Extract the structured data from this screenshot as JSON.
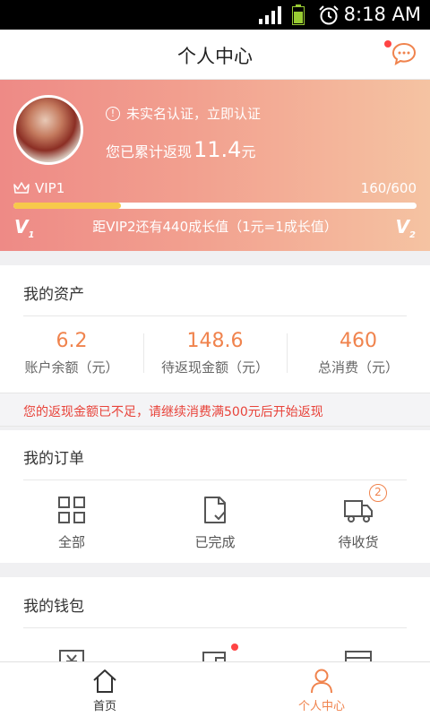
{
  "status_bar": {
    "time": "8:18 AM"
  },
  "header": {
    "title": "个人中心"
  },
  "profile": {
    "verify_text": "未实名认证，立即认证",
    "cashback_label": "您已累计返现",
    "cashback_amount": "11.4",
    "cashback_unit": "元",
    "vip_level": "VIP1",
    "growth_progress": "160/600",
    "progress_fraction": 0.267,
    "growth_hint": "距VIP2还有440成长值（1元=1成长值）",
    "level_from": "V",
    "level_from_num": "1",
    "level_to": "V",
    "level_to_num": "2"
  },
  "assets": {
    "title": "我的资产",
    "items": [
      {
        "value": "6.2",
        "label": "账户余额（元）"
      },
      {
        "value": "148.6",
        "label": "待返现金额（元）"
      },
      {
        "value": "460",
        "label": "总消费（元）"
      }
    ]
  },
  "notice": {
    "text": "您的返现金额已不足，请继续消费满500元后开始返现"
  },
  "orders": {
    "title": "我的订单",
    "items": [
      {
        "label": "全部",
        "icon": "grid-icon"
      },
      {
        "label": "已完成",
        "icon": "document-check-icon"
      },
      {
        "label": "待收货",
        "icon": "truck-icon",
        "badge": "2"
      }
    ]
  },
  "wallet": {
    "title": "我的钱包"
  },
  "bottom_nav": {
    "items": [
      {
        "label": "首页",
        "icon": "home-icon"
      },
      {
        "label": "个人中心",
        "icon": "person-icon"
      }
    ]
  },
  "colors": {
    "accent": "#f0834d",
    "alert": "#e8433a",
    "gauge_fill": "#f7c94b"
  }
}
